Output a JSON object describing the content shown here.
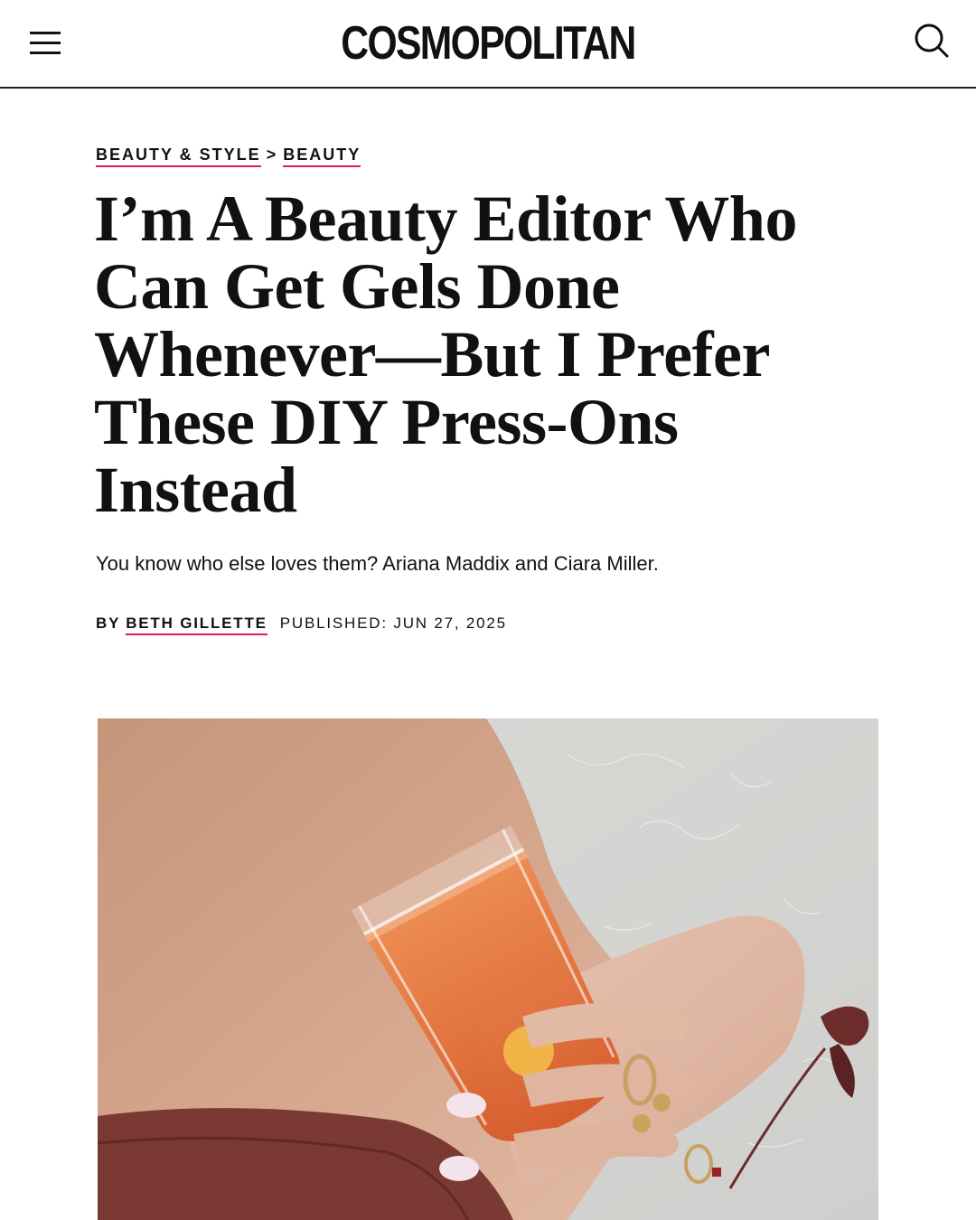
{
  "header": {
    "logo": "COSMOPOLITAN",
    "menu_icon": "hamburger-menu-icon",
    "search_icon": "search-icon"
  },
  "breadcrumb": {
    "parent": "BEAUTY & STYLE",
    "separator": ">",
    "current": "BEAUTY"
  },
  "article": {
    "headline": "I’m A Beauty Editor Who Can Get Gels Done Whenever—But I Prefer These DIY Press-Ons Instead",
    "dek": "You know who else loves them? Ariana Maddix and Ciara Miller.",
    "byline_prefix": "BY",
    "author": "BETH GILLETTE",
    "published": "PUBLISHED: JUN 27, 2025"
  },
  "colors": {
    "accent": "#e0214e",
    "text": "#111111"
  }
}
